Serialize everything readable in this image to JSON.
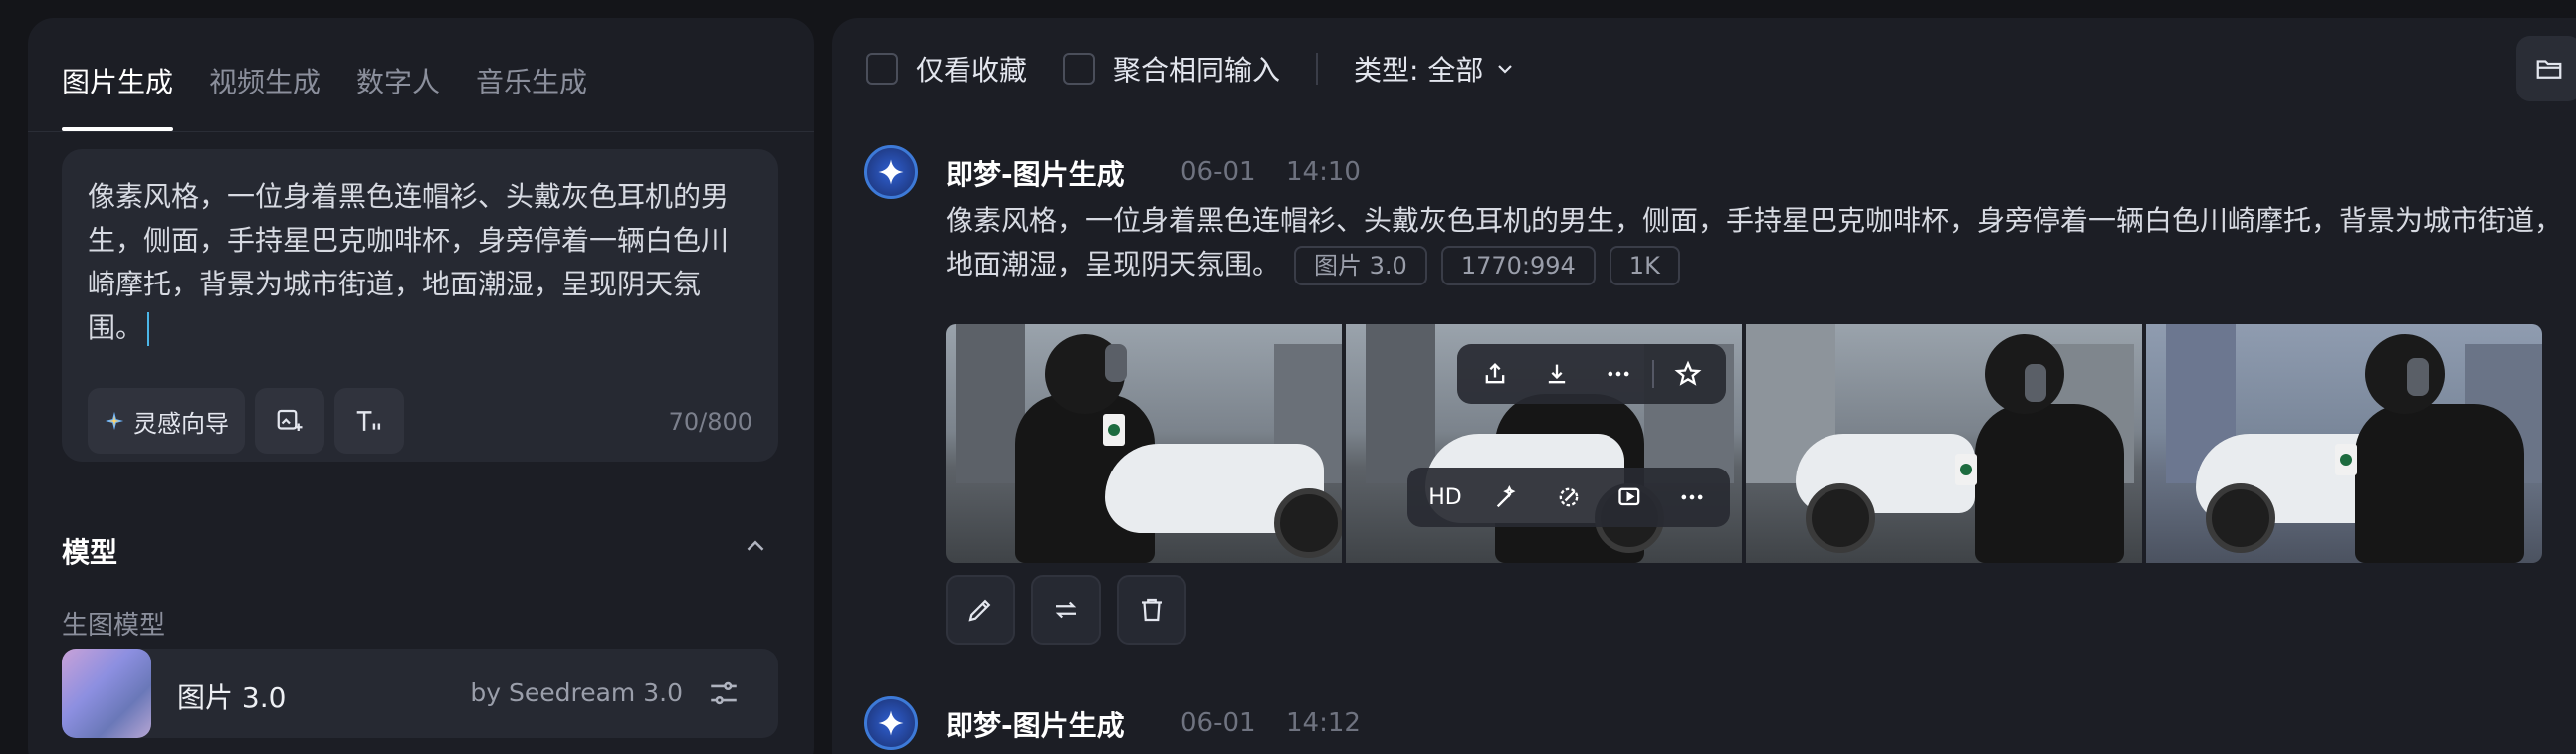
{
  "left": {
    "tabs": [
      {
        "label": "图片生成",
        "active": true
      },
      {
        "label": "视频生成",
        "active": false
      },
      {
        "label": "数字人",
        "active": false
      },
      {
        "label": "音乐生成",
        "active": false
      }
    ],
    "prompt": {
      "text": "像素风格，一位身着黑色连帽衫、头戴灰色耳机的男生，侧面，手持星巴克咖啡杯，身旁停着一辆白色川崎摩托，背景为城市街道，地面潮湿，呈现阴天氛围。",
      "inspiration_label": "灵感向导",
      "char_count": "70/800"
    },
    "model_section": {
      "title": "模型",
      "subtitle": "生图模型",
      "model_name": "图片 3.0",
      "model_by": "by Seedream 3.0"
    }
  },
  "right": {
    "filters": {
      "favorites_label": "仅看收藏",
      "merge_label": "聚合相同输入",
      "type_label": "类型: 全部"
    },
    "messages": [
      {
        "title": "即梦-图片生成",
        "date": "06-01",
        "time": "14:10",
        "prompt": "像素风格，一位身着黑色连帽衫、头戴灰色耳机的男生，侧面，手持星巴克咖啡杯，身旁停着一辆白色川崎摩托，背景为城市街道，地面潮湿，呈现阴天氛围。",
        "tags": [
          "图片 3.0",
          "1770:994",
          "1K"
        ],
        "hover_hd": "HD"
      },
      {
        "title": "即梦-图片生成",
        "date": "06-01",
        "time": "14:12"
      }
    ]
  },
  "colors": {
    "background": "#141519",
    "panel": "#1c1e25",
    "accent": "#4bb6e8",
    "avatar": "#2f5fd0"
  },
  "icons": [
    "sparkle-icon",
    "image-add-icon",
    "text-format-icon",
    "chevron-up-icon",
    "sliders-icon",
    "chevron-down-icon",
    "folder-icon",
    "dreamina-logo-icon",
    "share-icon",
    "download-icon",
    "more-icon",
    "star-icon",
    "magic-wand-icon",
    "eraser-icon",
    "video-play-icon",
    "edit-icon",
    "regenerate-icon",
    "delete-icon"
  ]
}
